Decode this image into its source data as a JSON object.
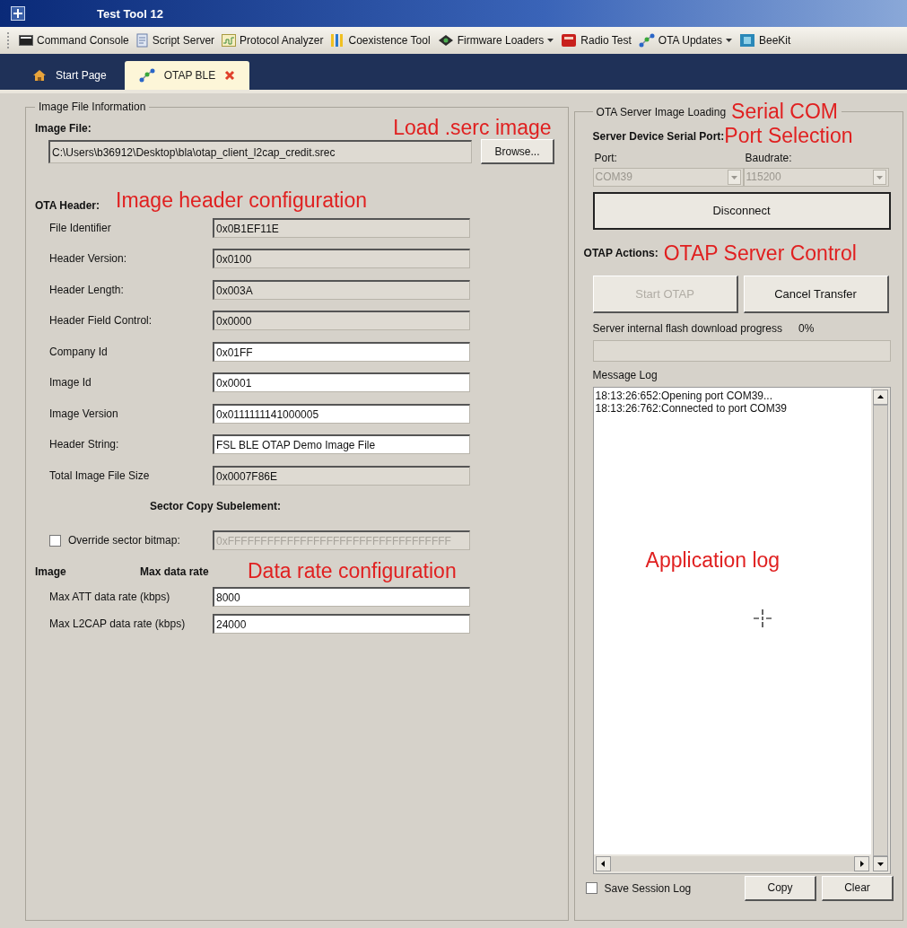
{
  "window": {
    "title": "Test Tool 12"
  },
  "toolbar": [
    {
      "label": "Command Console",
      "kind": "console",
      "dropdown": false
    },
    {
      "label": "Script Server",
      "kind": "document",
      "dropdown": false
    },
    {
      "label": "Protocol Analyzer",
      "kind": "chart",
      "dropdown": false
    },
    {
      "label": "Coexistence Tool",
      "kind": "bars",
      "dropdown": false
    },
    {
      "label": "Firmware Loaders",
      "kind": "chip",
      "dropdown": true
    },
    {
      "label": "Radio Test",
      "kind": "logo",
      "dropdown": false
    },
    {
      "label": "OTA Updates",
      "kind": "network",
      "dropdown": true
    },
    {
      "label": "BeeKit",
      "kind": "board",
      "dropdown": false
    }
  ],
  "tabs": [
    {
      "label": "Start Page",
      "kind": "home",
      "selected": false,
      "closable": false
    },
    {
      "label": "OTAP BLE",
      "kind": "network",
      "selected": true,
      "closable": true
    }
  ],
  "image_file_group": {
    "title": "Image File Information",
    "image_file_label": "Image File:",
    "image_file_path": "C:\\Users\\b36912\\Desktop\\bla\\otap_client_l2cap_credit.srec",
    "browse_button": "Browse...",
    "ota_header_label": "OTA Header:",
    "header_fields": [
      {
        "label": "File Identifier",
        "value": "0x0B1EF11E",
        "editable": false
      },
      {
        "label": "Header Version:",
        "value": "0x0100",
        "editable": false
      },
      {
        "label": "Header Length:",
        "value": "0x003A",
        "editable": false
      },
      {
        "label": "Header Field Control:",
        "value": "0x0000",
        "editable": false
      },
      {
        "label": "Company Id",
        "value": "0x01FF",
        "editable": true
      },
      {
        "label": "Image Id",
        "value": "0x0001",
        "editable": true
      },
      {
        "label": "Image Version",
        "value": "0x0111111141000005",
        "editable": true
      },
      {
        "label": "Header String:",
        "value": "FSL BLE OTAP Demo Image File",
        "editable": true
      },
      {
        "label": "Total Image File Size",
        "value": "0x0007F86E",
        "editable": false
      }
    ],
    "sector_heading": "Sector Copy Subelement:",
    "override_sector_bitmap": {
      "label": "Override sector bitmap:",
      "checked": false,
      "value": "0xFFFFFFFFFFFFFFFFFFFFFFFFFFFFFFFFFF",
      "disabled": true
    },
    "rate_heading_1": "Image",
    "rate_heading_2": "Max data rate",
    "rate_fields": [
      {
        "label": "Max ATT data rate (kbps)",
        "value": "8000",
        "editable": true
      },
      {
        "label": "Max L2CAP data rate (kbps)",
        "value": "24000",
        "editable": true
      }
    ]
  },
  "server_group": {
    "title": "OTA Server Image Loading",
    "serial_port_label": "Server Device Serial Port:",
    "port": {
      "label": "Port:",
      "value": "COM39",
      "disabled": true
    },
    "baudrate": {
      "label": "Baudrate:",
      "value": "115200",
      "disabled": true
    },
    "disconnect_button": "Disconnect",
    "otap_actions_label": "OTAP Actions:",
    "action_buttons": [
      {
        "label": "Start OTAP",
        "disabled": true
      },
      {
        "label": "Cancel Transfer",
        "disabled": false
      }
    ],
    "progress_label": "Server internal flash download progress",
    "progress_percent": "0%",
    "progress": {
      "level": 0
    },
    "message_log_label": "Message Log",
    "log_lines": [
      "18:13:26:652:Opening port COM39...",
      "18:13:26:762:Connected to port COM39"
    ],
    "save_session_log": {
      "label": "Save Session Log",
      "checked": false
    },
    "bottom_buttons": [
      "Copy",
      "Clear"
    ]
  },
  "annotations": {
    "load_image": "Load .serc image",
    "header_config": "Image header configuration",
    "data_rate": "Data rate configuration",
    "serial_com": "Serial COM",
    "port_selection": "Port Selection",
    "server_control": "OTAP Server Control",
    "application_log": "Application log"
  }
}
